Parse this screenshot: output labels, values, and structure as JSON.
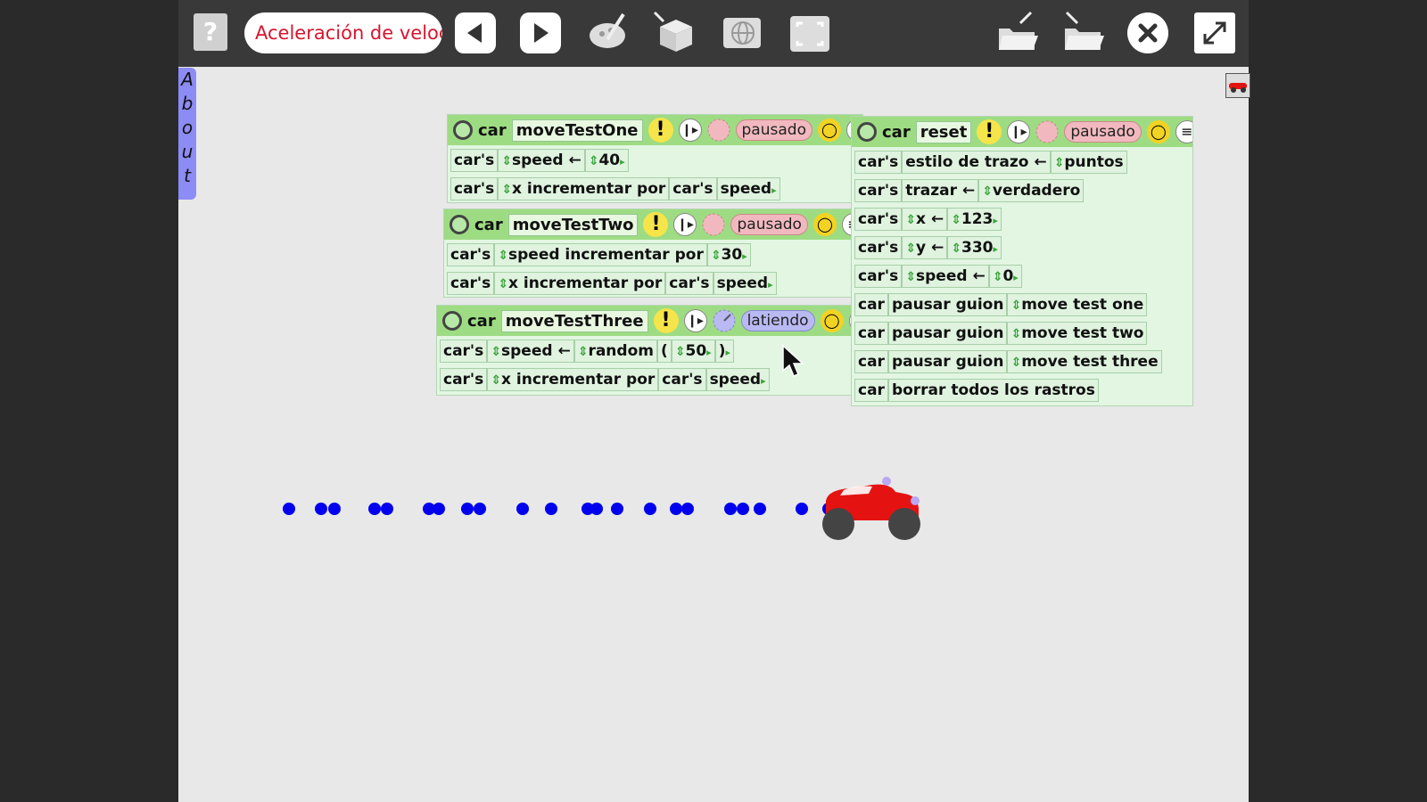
{
  "toolbar": {
    "help_label": "?",
    "project_title": "Aceleración de velocidad"
  },
  "about_flap": {
    "letters": [
      "A",
      "b",
      "o",
      "u",
      "t"
    ]
  },
  "scripts": [
    {
      "object": "car",
      "name": "moveTestOne",
      "status": "pausado",
      "rows": [
        {
          "obj": "car's",
          "parts": [
            "speed",
            "←",
            "40"
          ]
        },
        {
          "obj": "car's",
          "parts": [
            "x incrementar por",
            "car's",
            "speed"
          ]
        }
      ]
    },
    {
      "object": "car",
      "name": "moveTestTwo",
      "status": "pausado",
      "rows": [
        {
          "obj": "car's",
          "parts": [
            "speed incrementar por",
            "30"
          ]
        },
        {
          "obj": "car's",
          "parts": [
            "x incrementar por",
            "car's",
            "speed"
          ]
        }
      ]
    },
    {
      "object": "car",
      "name": "moveTestThree",
      "status": "latiendo",
      "rows": [
        {
          "obj": "car's",
          "parts": [
            "speed",
            "←",
            "random",
            "(",
            "50",
            ")"
          ]
        },
        {
          "obj": "car's",
          "parts": [
            "x incrementar por",
            "car's",
            "speed"
          ]
        }
      ]
    },
    {
      "object": "car",
      "name": "reset",
      "status": "pausado",
      "rows": [
        {
          "obj": "car's",
          "parts": [
            "estilo de trazo",
            "←",
            "puntos"
          ]
        },
        {
          "obj": "car's",
          "parts": [
            "trazar",
            "←",
            "verdadero"
          ]
        },
        {
          "obj": "car's",
          "parts": [
            "x",
            "←",
            "123"
          ]
        },
        {
          "obj": "car's",
          "parts": [
            "y",
            "←",
            "330"
          ]
        },
        {
          "obj": "car's",
          "parts": [
            "speed",
            "←",
            "0"
          ]
        },
        {
          "obj": "car",
          "parts": [
            "pausar guion",
            "move test one"
          ]
        },
        {
          "obj": "car",
          "parts": [
            "pausar guion",
            "move test two"
          ]
        },
        {
          "obj": "car",
          "parts": [
            "pausar guion",
            "move test three"
          ]
        },
        {
          "obj": "car",
          "parts": [
            "borrar todos los rastros"
          ]
        }
      ]
    }
  ],
  "colors": {
    "accent_title": "#d6152d",
    "trail": "#0000ee",
    "car": "#e51212"
  }
}
